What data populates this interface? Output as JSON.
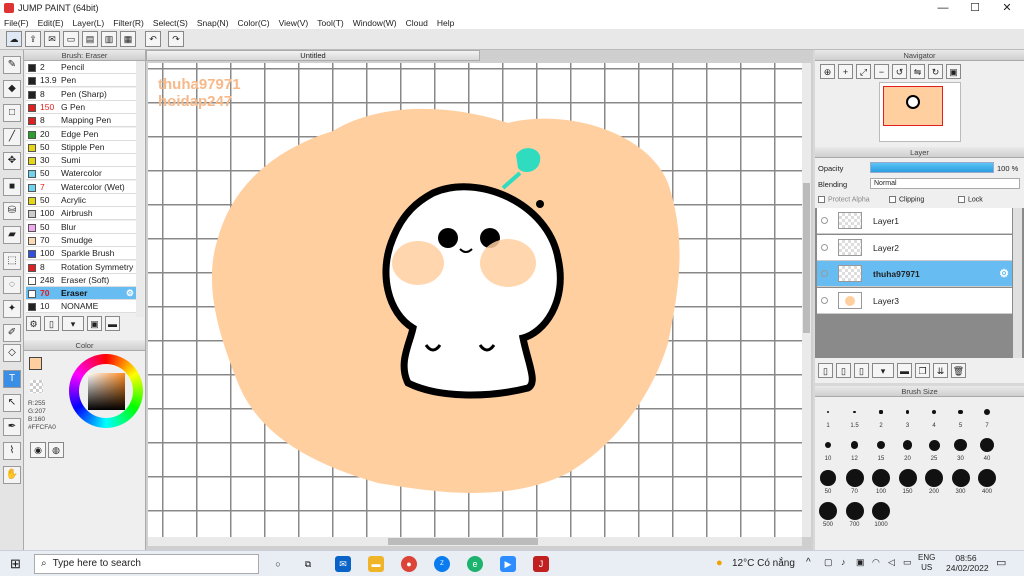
{
  "window": {
    "title": "JUMP PAINT (64bit)",
    "minimize": "—",
    "maximize": "☐",
    "close": "✕"
  },
  "menu": [
    "File(F)",
    "Edit(E)",
    "Layer(L)",
    "Filter(R)",
    "Select(S)",
    "Snap(N)",
    "Color(C)",
    "View(V)",
    "Tool(T)",
    "Window(W)",
    "Cloud",
    "Help"
  ],
  "document": {
    "tab": "Untitled"
  },
  "brush": {
    "header": "Brush: Eraser",
    "items": [
      {
        "size": "2",
        "name": "Pencil",
        "color": "#222222"
      },
      {
        "size": "13.9",
        "name": "Pen",
        "color": "#222222"
      },
      {
        "size": "8",
        "name": "Pen (Sharp)",
        "color": "#222222"
      },
      {
        "size": "150",
        "name": "G Pen",
        "color": "#e02020",
        "size_red": true
      },
      {
        "size": "8",
        "name": "Mapping Pen",
        "color": "#e02020"
      },
      {
        "size": "20",
        "name": "Edge Pen",
        "color": "#2aa02a"
      },
      {
        "size": "50",
        "name": "Stipple Pen",
        "color": "#e6d61a"
      },
      {
        "size": "30",
        "name": "Sumi",
        "color": "#e6d61a"
      },
      {
        "size": "50",
        "name": "Watercolor",
        "color": "#6fd3f0"
      },
      {
        "size": "7",
        "name": "Watercolor (Wet)",
        "color": "#6fd3f0",
        "size_red": true
      },
      {
        "size": "50",
        "name": "Acrylic",
        "color": "#e6d61a"
      },
      {
        "size": "100",
        "name": "Airbrush",
        "color": "#cccccc"
      },
      {
        "size": "50",
        "name": "Blur",
        "color": "#f0a8f0"
      },
      {
        "size": "70",
        "name": "Smudge",
        "color": "#ffd9b5"
      },
      {
        "size": "100",
        "name": "Sparkle Brush",
        "color": "#3050e0"
      },
      {
        "size": "8",
        "name": "Rotation Symmetry",
        "color": "#e02020"
      },
      {
        "size": "248",
        "name": "Eraser (Soft)",
        "color": "#ffffff"
      },
      {
        "size": "70",
        "name": "Eraser",
        "color": "#ffffff",
        "selected": true,
        "size_red": true
      },
      {
        "size": "10",
        "name": "NONAME",
        "color": "#222222"
      }
    ]
  },
  "color": {
    "header": "Color",
    "r": "R:255",
    "g": "G:207",
    "b": "B:160",
    "hex": "#FFCFA0",
    "current": "#ffcfa0"
  },
  "canvas": {
    "watermark1": "thuha97971",
    "watermark2": "hoidap247"
  },
  "navigator": {
    "header": "Navigator"
  },
  "layer": {
    "header": "Layer",
    "opacity_label": "Opacity",
    "opacity_value": "100 %",
    "opacity": 1.0,
    "blending_label": "Blending",
    "blending_value": "Normal",
    "protect_alpha": "Protect Alpha",
    "clipping": "Clipping",
    "lock": "Lock",
    "layers": [
      {
        "name": "Layer1"
      },
      {
        "name": "Layer2"
      },
      {
        "name": "thuha97971",
        "selected": true
      },
      {
        "name": "Layer3"
      }
    ]
  },
  "brush_size": {
    "header": "Brush Size",
    "sizes": [
      "1",
      "1.5",
      "2",
      "3",
      "4",
      "5",
      "7",
      "10",
      "12",
      "15",
      "20",
      "25",
      "30",
      "40",
      "50",
      "70",
      "100",
      "150",
      "200",
      "300",
      "400",
      "500",
      "700",
      "1000"
    ]
  },
  "taskbar": {
    "search_placeholder": "Type here to search",
    "weather": "12°C Có nắng",
    "lang1": "ENG",
    "lang2": "US",
    "time": "08:56",
    "date": "24/02/2022"
  }
}
